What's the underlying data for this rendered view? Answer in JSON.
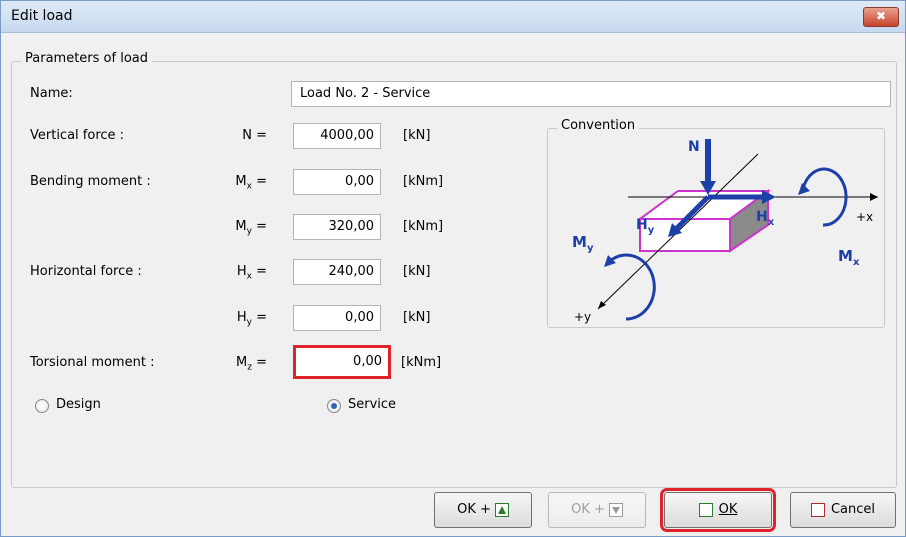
{
  "window": {
    "title": "Edit load",
    "close_glyph": "✖"
  },
  "group": {
    "title": "Parameters of load"
  },
  "name_row": {
    "label": "Name:",
    "value": "Load No. 2 - Service"
  },
  "rows": [
    {
      "label": "Vertical force :",
      "sym": "N",
      "sub": "",
      "value": "4000,00",
      "unit": "[kN]"
    },
    {
      "label": "Bending moment :",
      "sym": "M",
      "sub": "x",
      "value": "0,00",
      "unit": "[kNm]"
    },
    {
      "label": "",
      "sym": "M",
      "sub": "y",
      "value": "320,00",
      "unit": "[kNm]"
    },
    {
      "label": "Horizontal force :",
      "sym": "H",
      "sub": "x",
      "value": "240,00",
      "unit": "[kN]"
    },
    {
      "label": "",
      "sym": "H",
      "sub": "y",
      "value": "0,00",
      "unit": "[kN]"
    },
    {
      "label": "Torsional moment :",
      "sym": "M",
      "sub": "z",
      "value": "0,00",
      "unit": "[kNm]"
    }
  ],
  "equals": "=",
  "convention": {
    "title": "Convention",
    "labels": {
      "n": "N",
      "hx": "H",
      "hx_sub": "x",
      "hy": "H",
      "hy_sub": "y",
      "mx": "M",
      "mx_sub": "x",
      "my": "M",
      "my_sub": "y",
      "plus_x": "+x",
      "plus_y": "+y"
    },
    "colors": {
      "box_edge": "#cc33cc",
      "box_side": "#8a8a8a",
      "arrow": "#1d3fa8"
    }
  },
  "load_type": {
    "options": [
      "Design",
      "Service"
    ],
    "selected": "Service"
  },
  "buttons": {
    "ok_up": "OK +",
    "ok_down": "OK +",
    "ok": "OK",
    "cancel": "Cancel"
  },
  "colors": {
    "highlight": "#e0222a",
    "title_bg": "#c6d9ef",
    "close_bg": "#c7442c"
  }
}
